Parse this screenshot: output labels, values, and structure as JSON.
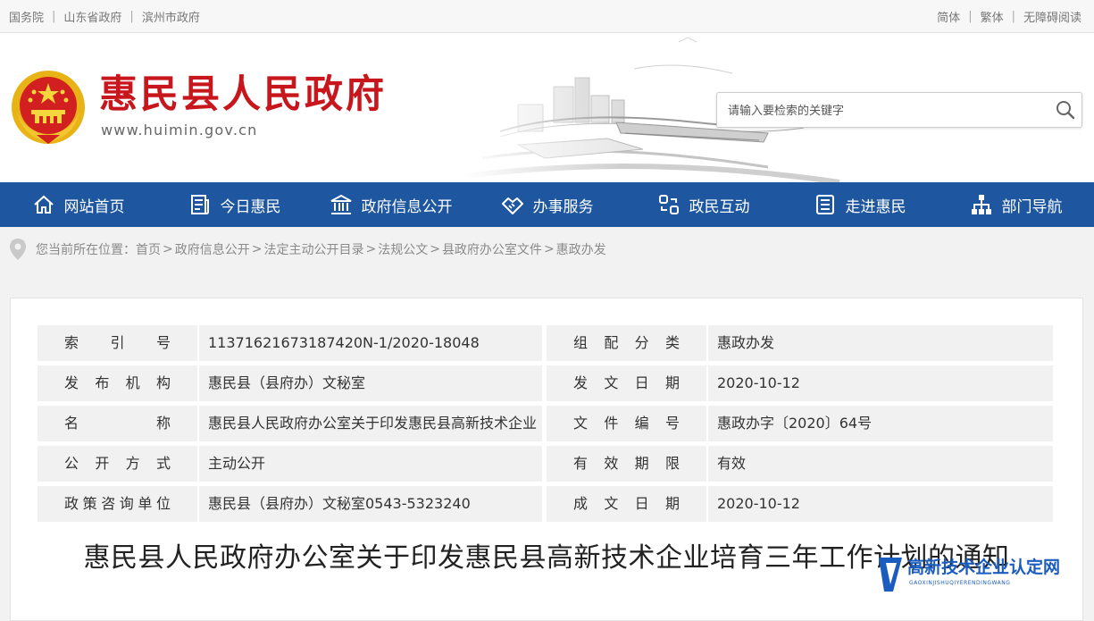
{
  "topbar": {
    "links_left": [
      "国务院",
      "山东省政府",
      "滨州市政府"
    ],
    "links_right": [
      "简体",
      "繁体",
      "无障碍阅读"
    ],
    "separator": "|"
  },
  "header": {
    "site_title": "惠民县人民政府",
    "site_domain": "www.huimin.gov.cn",
    "search_placeholder": "请输入要检索的关键字"
  },
  "nav": {
    "items": [
      {
        "label": "网站首页",
        "icon": "home-icon"
      },
      {
        "label": "今日惠民",
        "icon": "news-icon"
      },
      {
        "label": "政府信息公开",
        "icon": "government-building-icon"
      },
      {
        "label": "办事服务",
        "icon": "handshake-icon"
      },
      {
        "label": "政民互动",
        "icon": "interaction-icon"
      },
      {
        "label": "走进惠民",
        "icon": "book-icon"
      },
      {
        "label": "部门导航",
        "icon": "org-chart-icon"
      }
    ],
    "background": "#1e57a0"
  },
  "breadcrumb": {
    "prefix": "您当前所在位置：",
    "items": [
      "首页",
      "政府信息公开",
      "法定主动公开目录",
      "法规公文",
      "县政府办公室文件",
      "惠政办发"
    ],
    "separator": ">"
  },
  "meta": {
    "rows": [
      {
        "label1": "索引号",
        "value1": "11371621673187420N-1/2020-18048",
        "label2": "组配分类",
        "value2": "惠政办发"
      },
      {
        "label1": "发布机构",
        "value1": "惠民县（县府办）文秘室",
        "label2": "发文日期",
        "value2": "2020-10-12"
      },
      {
        "label1": "名称",
        "value1": "惠民县人民政府办公室关于印发惠民县高新技术企业",
        "label2": "文件编号",
        "value2": "惠政办字〔2020〕64号"
      },
      {
        "label1": "公开方式",
        "value1": "主动公开",
        "label2": "有效期限",
        "value2": "有效"
      },
      {
        "label1": "政策咨询单位",
        "value1": "惠民县（县府办）文秘室0543-5323240",
        "label2": "成文日期",
        "value2": "2020-10-12"
      }
    ]
  },
  "document": {
    "title": "惠民县人民政府办公室关于印发惠民县高新技术企业培育三年工作计划的通知"
  },
  "watermark": {
    "main": "高新技术企业认定网",
    "sub": "GAOXINJISHUQIYERENDINGWANG"
  },
  "colors": {
    "brand_red": "#c8161d",
    "nav_blue": "#1e57a0",
    "watermark_blue": "#1a5cbf"
  }
}
